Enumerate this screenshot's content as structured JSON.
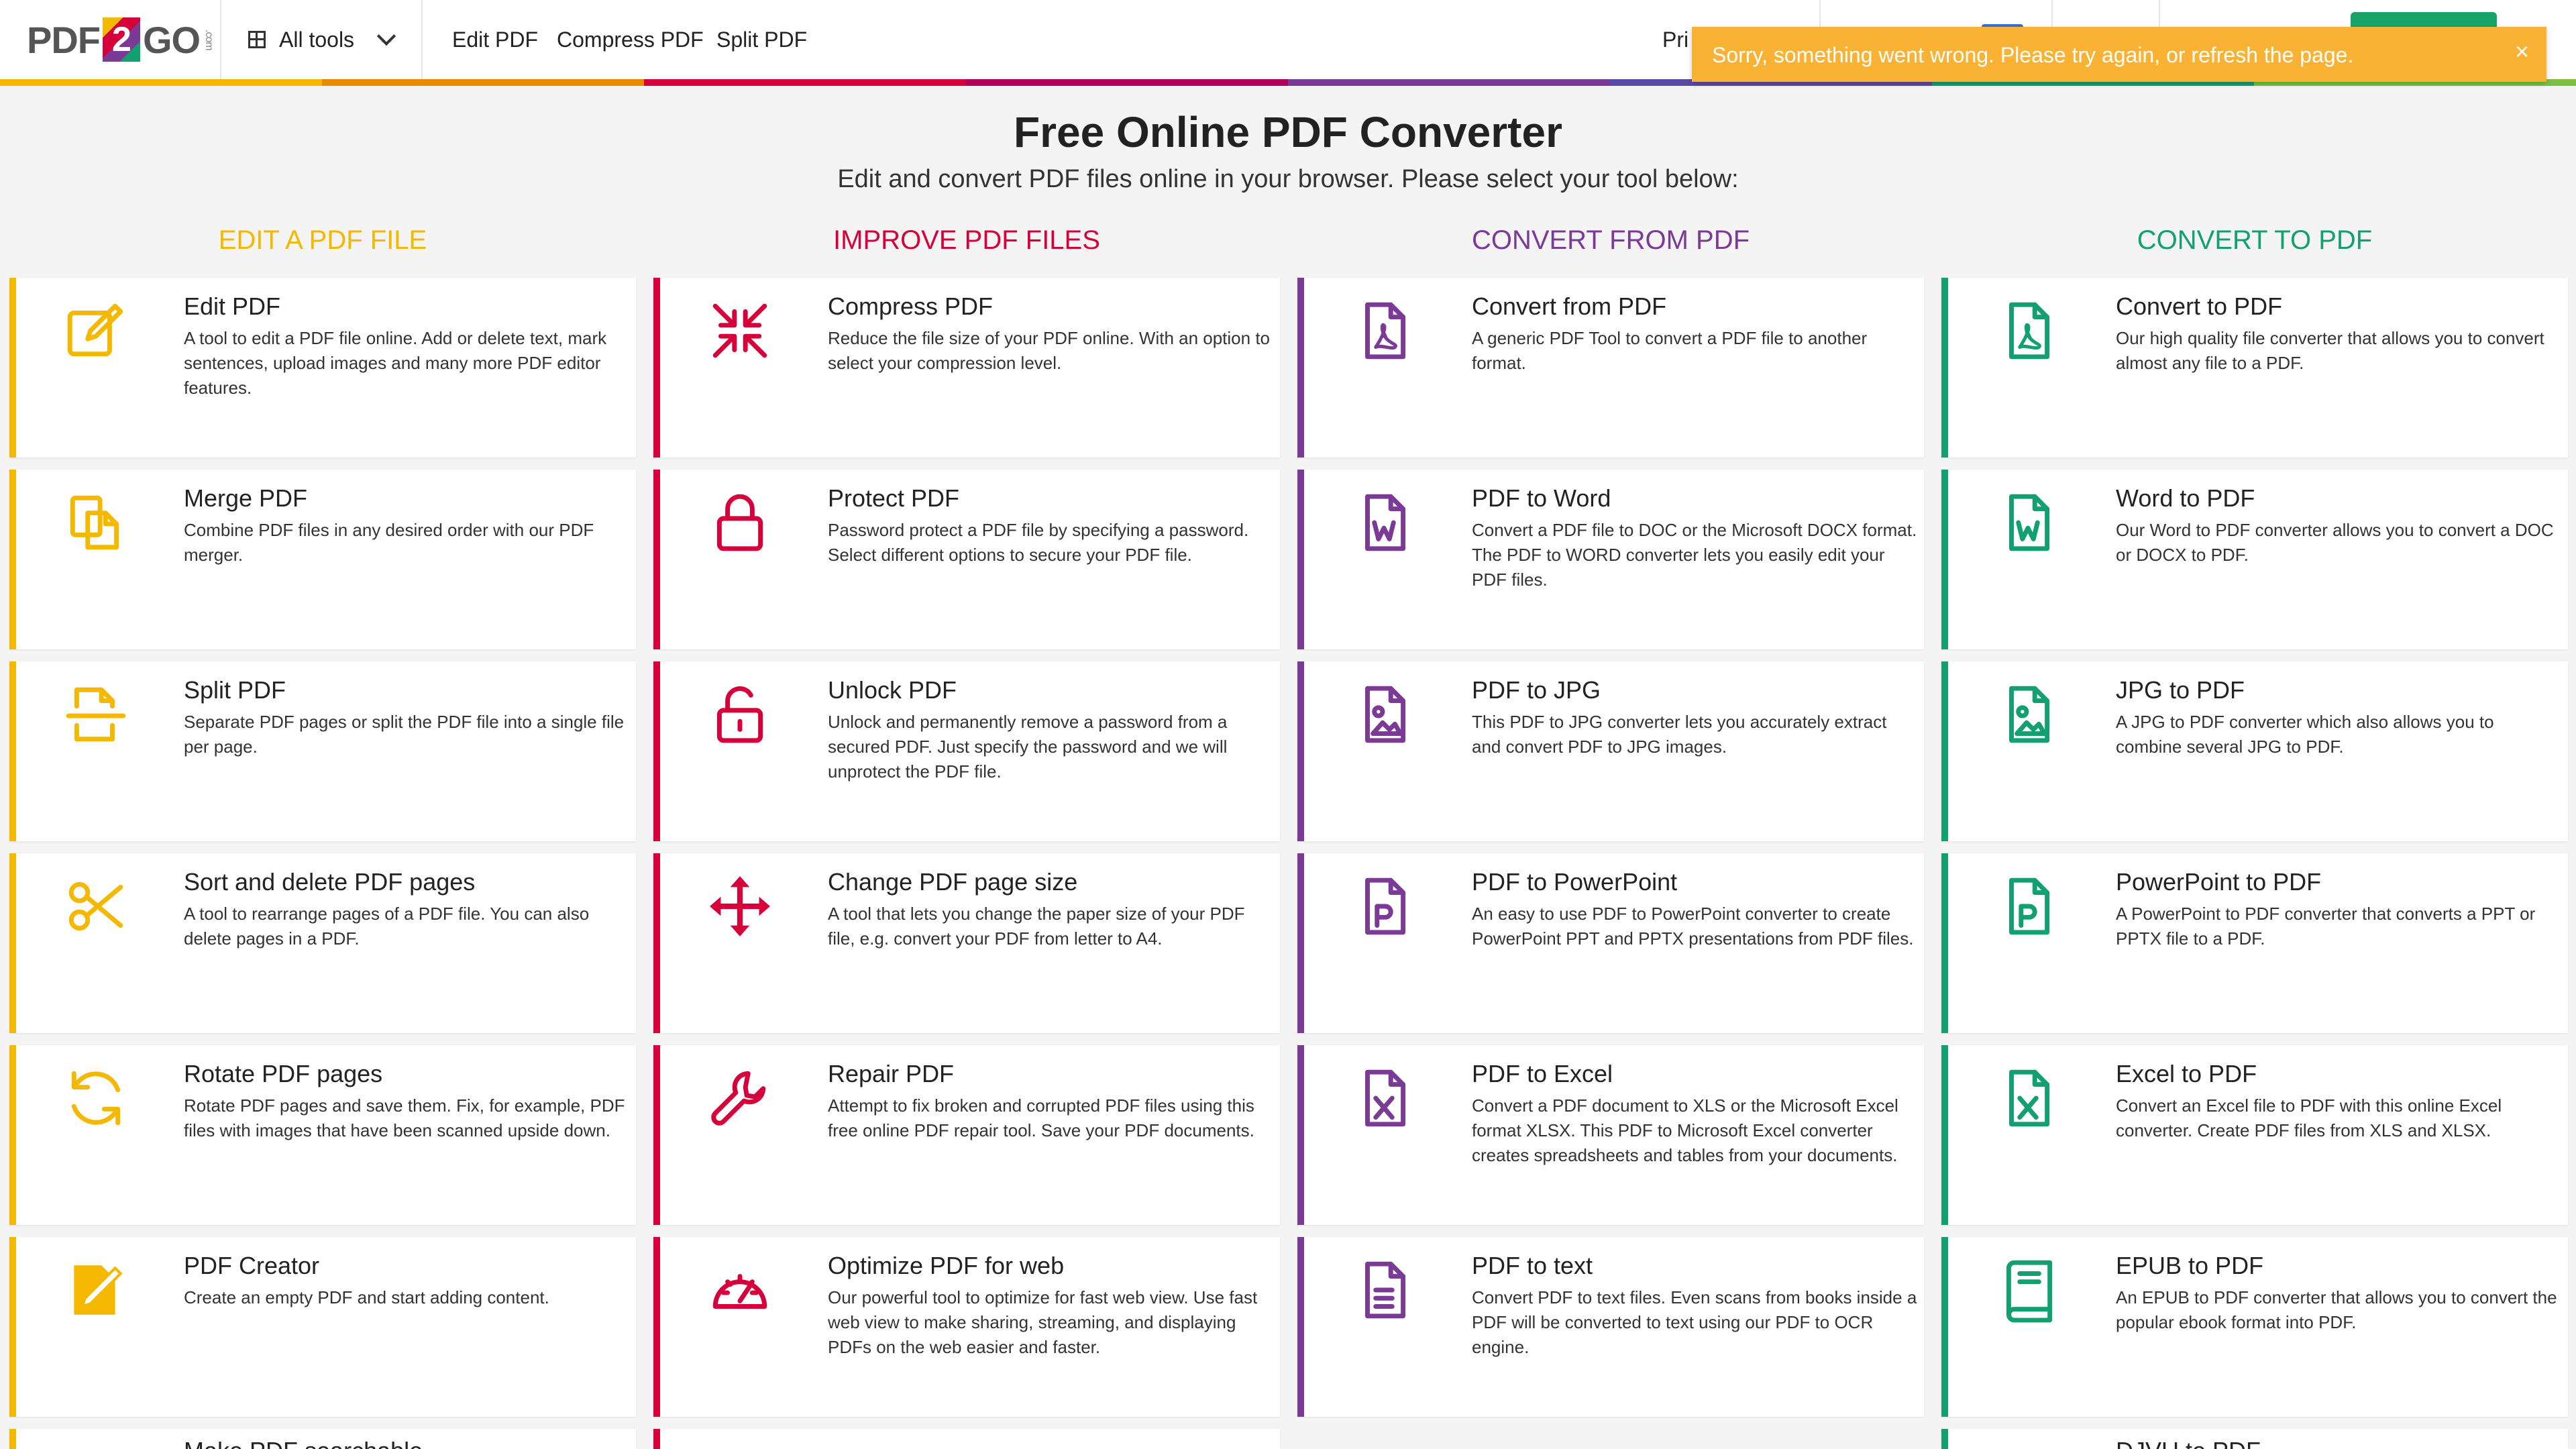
{
  "header": {
    "logo_text_left": "PDF",
    "logo_text_mid": "2",
    "logo_text_right": "GO",
    "logo_com": ".com",
    "all_tools": "All tools",
    "nav": [
      "Edit PDF",
      "Compress PDF",
      "Split PDF"
    ],
    "pricing": "Pri"
  },
  "toast": {
    "message": "Sorry, something went wrong. Please try again, or refresh the page.",
    "close": "×"
  },
  "page": {
    "title": "Free Online PDF Converter",
    "subtitle": "Edit and convert PDF files online in your browser. Please select your tool below:"
  },
  "colors": {
    "edit": "#f5b800",
    "improve": "#d6003a",
    "convert_from": "#7b3a96",
    "convert_to": "#12a070"
  },
  "columns": [
    {
      "heading": "Edit a PDF file",
      "color": "#f5b800",
      "tools": [
        {
          "title": "Edit PDF",
          "icon": "edit-icon",
          "desc": "A tool to edit a PDF file online. Add or delete text, mark sentences, upload images and many more PDF editor features."
        },
        {
          "title": "Merge PDF",
          "icon": "merge-icon",
          "desc": "Combine PDF files in any desired order with our PDF merger."
        },
        {
          "title": "Split PDF",
          "icon": "split-icon",
          "desc": "Separate PDF pages or split the PDF file into a single file per page."
        },
        {
          "title": "Sort and delete PDF pages",
          "icon": "scissors-icon",
          "desc": "A tool to rearrange pages of a PDF file. You can also delete pages in a PDF."
        },
        {
          "title": "Rotate PDF pages",
          "icon": "rotate-icon",
          "desc": "Rotate PDF pages and save them. Fix, for example, PDF files with images that have been scanned upside down."
        },
        {
          "title": "PDF Creator",
          "icon": "create-pdf-icon",
          "desc": "Create an empty PDF and start adding content."
        }
      ]
    },
    {
      "heading": "Improve PDF files",
      "color": "#d6003a",
      "tools": [
        {
          "title": "Compress PDF",
          "icon": "compress-icon",
          "desc": "Reduce the file size of your PDF online. With an option to select your compression level."
        },
        {
          "title": "Protect PDF",
          "icon": "lock-icon",
          "desc": "Password protect a PDF file by specifying a password. Select different options to secure your PDF file."
        },
        {
          "title": "Unlock PDF",
          "icon": "unlock-icon",
          "desc": "Unlock and permanently remove a password from a secured PDF. Just specify the password and we will unprotect the PDF file."
        },
        {
          "title": "Change PDF page size",
          "icon": "move-arrows-icon",
          "desc": "A tool that lets you change the paper size of your PDF file, e.g. convert your PDF from letter to A4."
        },
        {
          "title": "Repair PDF",
          "icon": "wrench-icon",
          "desc": "Attempt to fix broken and corrupted PDF files using this free online PDF repair tool. Save your PDF documents."
        },
        {
          "title": "Optimize PDF for web",
          "icon": "speedometer-icon",
          "desc": "Our powerful tool to optimize for fast web view. Use fast web view to make sharing, streaming, and displaying PDFs on the web easier and faster."
        }
      ]
    },
    {
      "heading": "Convert from PDF",
      "color": "#7b3a96",
      "tools": [
        {
          "title": "Convert from PDF",
          "icon": "pdf-file-icon",
          "desc": "A generic PDF Tool to convert a PDF file to another format."
        },
        {
          "title": "PDF to Word",
          "icon": "word-file-icon",
          "desc": "Convert a PDF file to DOC or the Microsoft DOCX format. The PDF to WORD converter lets you easily edit your PDF files."
        },
        {
          "title": "PDF to JPG",
          "icon": "image-file-icon",
          "desc": "This PDF to JPG converter lets you accurately extract and convert PDF to JPG images."
        },
        {
          "title": "PDF to PowerPoint",
          "icon": "powerpoint-file-icon",
          "desc": "An easy to use PDF to PowerPoint converter to create PowerPoint PPT and PPTX presentations from PDF files."
        },
        {
          "title": "PDF to Excel",
          "icon": "excel-file-icon",
          "desc": "Convert a PDF document to XLS or the Microsoft Excel format XLSX. This PDF to Microsoft Excel converter creates spreadsheets and tables from your documents."
        },
        {
          "title": "PDF to text",
          "icon": "text-file-icon",
          "desc": "Convert PDF to text files. Even scans from books inside a PDF will be converted to text using our PDF to OCR engine."
        }
      ]
    },
    {
      "heading": "Convert to PDF",
      "color": "#12a070",
      "tools": [
        {
          "title": "Convert to PDF",
          "icon": "pdf-file-icon",
          "desc": "Our high quality file converter that allows you to convert almost any file to a PDF."
        },
        {
          "title": "Word to PDF",
          "icon": "word-file-icon",
          "desc": "Our Word to PDF converter allows you to convert a DOC or DOCX to PDF."
        },
        {
          "title": "JPG to PDF",
          "icon": "image-file-icon",
          "desc": "A JPG to PDF converter which also allows you to combine several JPG to PDF."
        },
        {
          "title": "PowerPoint to PDF",
          "icon": "powerpoint-file-icon",
          "desc": "A PowerPoint to PDF converter that converts a PPT or PPTX file to a PDF."
        },
        {
          "title": "Excel to PDF",
          "icon": "excel-file-icon",
          "desc": "Convert an Excel file to PDF with this online Excel converter. Create PDF files from XLS and XLSX."
        },
        {
          "title": "EPUB to PDF",
          "icon": "book-icon",
          "desc": "An EPUB to PDF converter that allows you to convert the popular ebook format into PDF."
        }
      ]
    }
  ],
  "partial_row": [
    "Make PDF searchable",
    "",
    "",
    "DJVU to PDF"
  ]
}
